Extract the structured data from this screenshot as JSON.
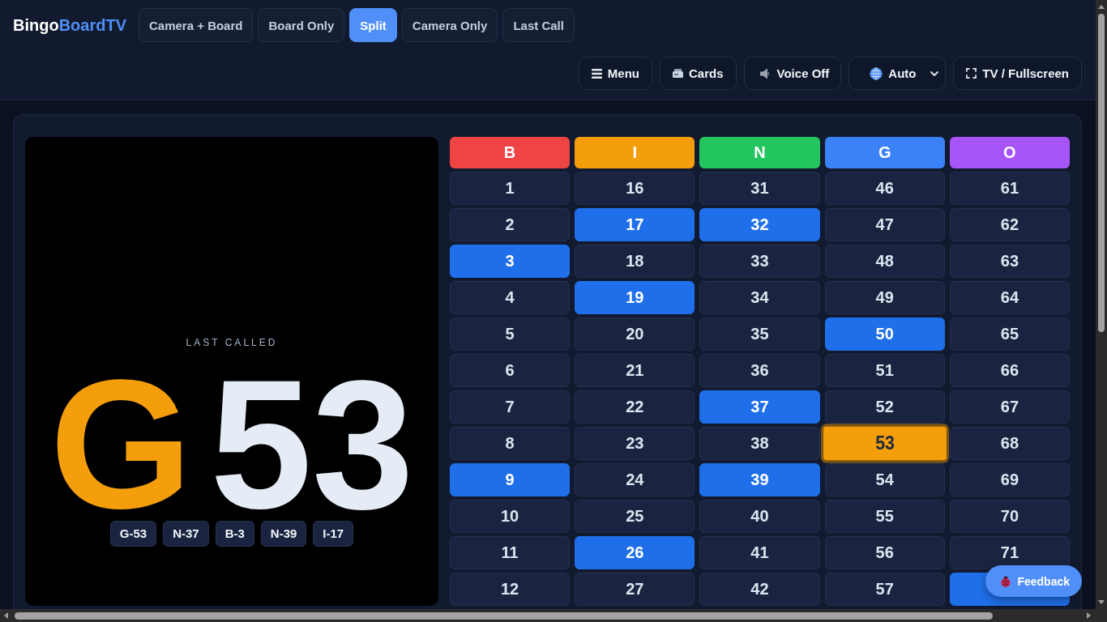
{
  "header": {
    "logo": {
      "name": "Bingo",
      "accent": "BoardTV"
    },
    "tabs": [
      {
        "label": "Camera + Board",
        "selected": false
      },
      {
        "label": "Board Only",
        "selected": false
      },
      {
        "label": "Split",
        "selected": true
      },
      {
        "label": "Camera Only",
        "selected": false
      },
      {
        "label": "Last Call",
        "selected": false
      }
    ],
    "toolbar": [
      {
        "kind": "menu",
        "label": "Menu"
      },
      {
        "kind": "cards",
        "label": "Cards"
      },
      {
        "kind": "voice",
        "label": "Voice Off"
      },
      {
        "kind": "select",
        "value": "Auto"
      },
      {
        "kind": "fullscreen",
        "label": "TV / Fullscreen"
      }
    ]
  },
  "last_called": {
    "label": "LAST CALLED",
    "letter": "G",
    "number": "53",
    "recent": [
      "G-53",
      "N-37",
      "B-3",
      "N-39",
      "I-17"
    ]
  },
  "board": {
    "columns": [
      {
        "letter": "B",
        "color": "#ef4444"
      },
      {
        "letter": "I",
        "color": "#f59e0b"
      },
      {
        "letter": "N",
        "color": "#22c55e"
      },
      {
        "letter": "G",
        "color": "#3b82f6"
      },
      {
        "letter": "O",
        "color": "#a855f7"
      }
    ],
    "rows": [
      {
        "cells": [
          {
            "number": "1",
            "called": false,
            "current": false
          },
          {
            "number": "16",
            "called": false,
            "current": false
          },
          {
            "number": "31",
            "called": false,
            "current": false
          },
          {
            "number": "46",
            "called": false,
            "current": false
          },
          {
            "number": "61",
            "called": false,
            "current": false
          }
        ]
      },
      {
        "cells": [
          {
            "number": "2",
            "called": false,
            "current": false
          },
          {
            "number": "17",
            "called": true,
            "current": false
          },
          {
            "number": "32",
            "called": true,
            "current": false
          },
          {
            "number": "47",
            "called": false,
            "current": false
          },
          {
            "number": "62",
            "called": false,
            "current": false
          }
        ]
      },
      {
        "cells": [
          {
            "number": "3",
            "called": true,
            "current": false
          },
          {
            "number": "18",
            "called": false,
            "current": false
          },
          {
            "number": "33",
            "called": false,
            "current": false
          },
          {
            "number": "48",
            "called": false,
            "current": false
          },
          {
            "number": "63",
            "called": false,
            "current": false
          }
        ]
      },
      {
        "cells": [
          {
            "number": "4",
            "called": false,
            "current": false
          },
          {
            "number": "19",
            "called": true,
            "current": false
          },
          {
            "number": "34",
            "called": false,
            "current": false
          },
          {
            "number": "49",
            "called": false,
            "current": false
          },
          {
            "number": "64",
            "called": false,
            "current": false
          }
        ]
      },
      {
        "cells": [
          {
            "number": "5",
            "called": false,
            "current": false
          },
          {
            "number": "20",
            "called": false,
            "current": false
          },
          {
            "number": "35",
            "called": false,
            "current": false
          },
          {
            "number": "50",
            "called": true,
            "current": false
          },
          {
            "number": "65",
            "called": false,
            "current": false
          }
        ]
      },
      {
        "cells": [
          {
            "number": "6",
            "called": false,
            "current": false
          },
          {
            "number": "21",
            "called": false,
            "current": false
          },
          {
            "number": "36",
            "called": false,
            "current": false
          },
          {
            "number": "51",
            "called": false,
            "current": false
          },
          {
            "number": "66",
            "called": false,
            "current": false
          }
        ]
      },
      {
        "cells": [
          {
            "number": "7",
            "called": false,
            "current": false
          },
          {
            "number": "22",
            "called": false,
            "current": false
          },
          {
            "number": "37",
            "called": true,
            "current": false
          },
          {
            "number": "52",
            "called": false,
            "current": false
          },
          {
            "number": "67",
            "called": false,
            "current": false
          }
        ]
      },
      {
        "cells": [
          {
            "number": "8",
            "called": false,
            "current": false
          },
          {
            "number": "23",
            "called": false,
            "current": false
          },
          {
            "number": "38",
            "called": false,
            "current": false
          },
          {
            "number": "53",
            "called": true,
            "current": true
          },
          {
            "number": "68",
            "called": false,
            "current": false
          }
        ]
      },
      {
        "cells": [
          {
            "number": "9",
            "called": true,
            "current": false
          },
          {
            "number": "24",
            "called": false,
            "current": false
          },
          {
            "number": "39",
            "called": true,
            "current": false
          },
          {
            "number": "54",
            "called": false,
            "current": false
          },
          {
            "number": "69",
            "called": false,
            "current": false
          }
        ]
      },
      {
        "cells": [
          {
            "number": "10",
            "called": false,
            "current": false
          },
          {
            "number": "25",
            "called": false,
            "current": false
          },
          {
            "number": "40",
            "called": false,
            "current": false
          },
          {
            "number": "55",
            "called": false,
            "current": false
          },
          {
            "number": "70",
            "called": false,
            "current": false
          }
        ]
      },
      {
        "cells": [
          {
            "number": "11",
            "called": false,
            "current": false
          },
          {
            "number": "26",
            "called": true,
            "current": false
          },
          {
            "number": "41",
            "called": false,
            "current": false
          },
          {
            "number": "56",
            "called": false,
            "current": false
          },
          {
            "number": "71",
            "called": false,
            "current": false
          }
        ]
      },
      {
        "cells": [
          {
            "number": "12",
            "called": false,
            "current": false
          },
          {
            "number": "27",
            "called": false,
            "current": false
          },
          {
            "number": "42",
            "called": false,
            "current": false
          },
          {
            "number": "57",
            "called": false,
            "current": false
          },
          {
            "called": true,
            "current": false
          }
        ]
      }
    ]
  },
  "feedback_button": {
    "label": "Feedback"
  }
}
